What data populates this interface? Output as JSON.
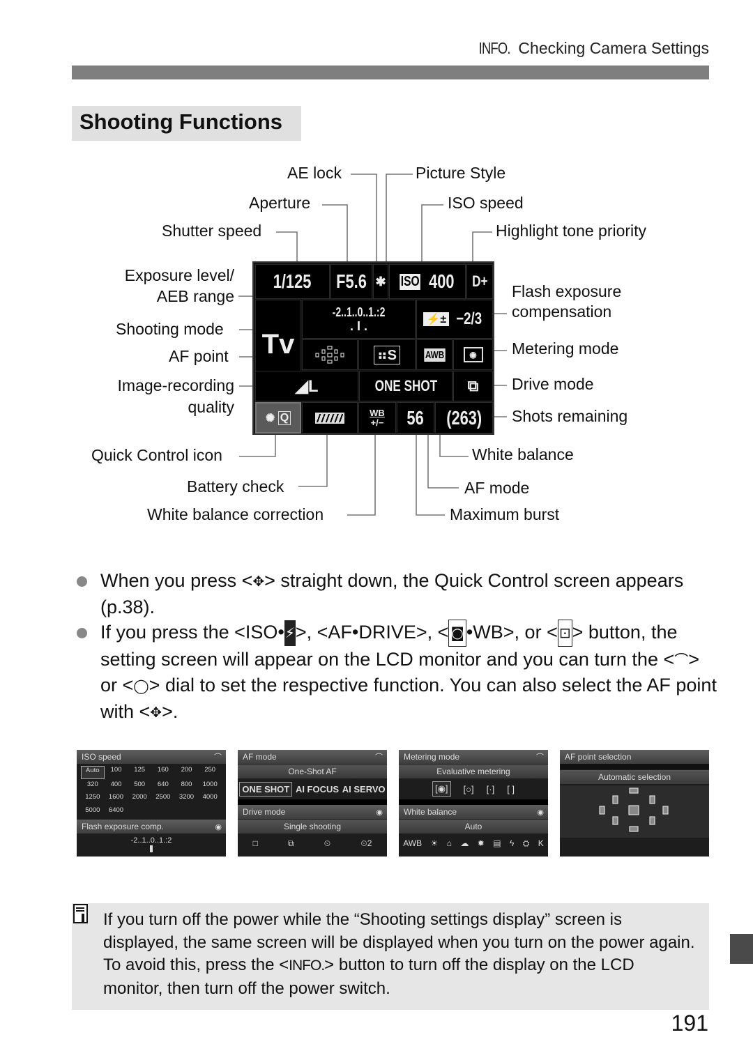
{
  "header": {
    "info_glyph": "INFO.",
    "title": "Checking Camera Settings"
  },
  "section_title": "Shooting Functions",
  "callouts": {
    "ae_lock": "AE lock",
    "aperture": "Aperture",
    "shutter_speed": "Shutter speed",
    "picture_style": "Picture Style",
    "iso_speed": "ISO speed",
    "highlight_tone_priority": "Highlight tone priority",
    "exposure_level_1": "Exposure level/",
    "exposure_level_2": "AEB range",
    "shooting_mode": "Shooting mode",
    "af_point": "AF point",
    "image_quality_1": "Image-recording",
    "image_quality_2": "quality",
    "flash_comp_1": "Flash exposure",
    "flash_comp_2": "compensation",
    "metering_mode": "Metering mode",
    "drive_mode": "Drive mode",
    "shots_remaining": "Shots remaining",
    "quick_control_icon": "Quick Control icon",
    "battery_check": "Battery check",
    "wb_correction": "White balance correction",
    "white_balance": "White balance",
    "af_mode": "AF mode",
    "maximum_burst": "Maximum burst"
  },
  "lcd": {
    "shutter": "1/125",
    "aperture": "F5.6",
    "ae_lock": "✱",
    "iso_badge": "ISO",
    "iso_value": "400",
    "htp": "D+",
    "exposure_scale": "-2..1..0..1.:2",
    "exposure_marks": ". I .",
    "mode": "Tv",
    "flash_badge": "±",
    "flash_value": "−2/3",
    "picture_style": "S",
    "wb": "AWB",
    "quality": "◢L",
    "af_mode": "ONE SHOT",
    "wb_shift_top": "WB",
    "wb_shift_bottom": "+/−",
    "max_burst": "56",
    "shots_remaining": "(263)",
    "qc_q": "Q"
  },
  "bullets": [
    {
      "parts": [
        "When you press <",
        "✥",
        "> straight down, the Quick Control screen appears (p.38)."
      ]
    },
    {
      "parts": [
        "If you press the <ISO•",
        "⚡",
        ">, <AF•DRIVE>, <",
        "◙",
        "•WB>, or <",
        "⊡",
        "> button, the setting screen will appear on the LCD monitor and you can turn the <",
        "⌒",
        "> or <",
        "◯",
        "> dial to set the respective function. You can also select the AF point with <",
        "✥",
        ">."
      ]
    }
  ],
  "screens": [
    {
      "title": "ISO speed",
      "iso_values": [
        "Auto",
        "100",
        "125",
        "160",
        "200",
        "250",
        "320",
        "400",
        "500",
        "640",
        "800",
        "1000",
        "1250",
        "1600",
        "2000",
        "2500",
        "3200",
        "4000",
        "5000",
        "6400"
      ],
      "selected": "Auto",
      "second_title": "Flash exposure comp.",
      "second_scale": "-2..1..0..1.:2"
    },
    {
      "title": "AF mode",
      "current": "One-Shot AF",
      "options": [
        "ONE SHOT",
        "AI FOCUS",
        "AI SERVO"
      ],
      "selected": "ONE SHOT",
      "second_title": "Drive mode",
      "second_current": "Single shooting",
      "second_options": [
        "□",
        "⧉",
        "⏲",
        "⏲2"
      ]
    },
    {
      "title": "Metering mode",
      "current": "Evaluative metering",
      "options": [
        "[◉]",
        "[○]",
        "[·]",
        "[ ]"
      ],
      "second_title": "White balance",
      "second_current": "Auto",
      "second_options": [
        "AWB",
        "☀",
        "⌂",
        "☁",
        "✹",
        "▤",
        "ϟ",
        "⛭",
        "K"
      ]
    },
    {
      "title": "AF point selection",
      "current": "Automatic selection"
    }
  ],
  "note": {
    "text_1": "If you turn off the power while the “Shooting settings display” screen is displayed, the same screen will be displayed when you turn on the power again. To avoid this, press the <",
    "info_glyph": "INFO.",
    "text_2": "> button to turn off the display on the LCD monitor, then turn off the power switch."
  },
  "page_number": "191"
}
